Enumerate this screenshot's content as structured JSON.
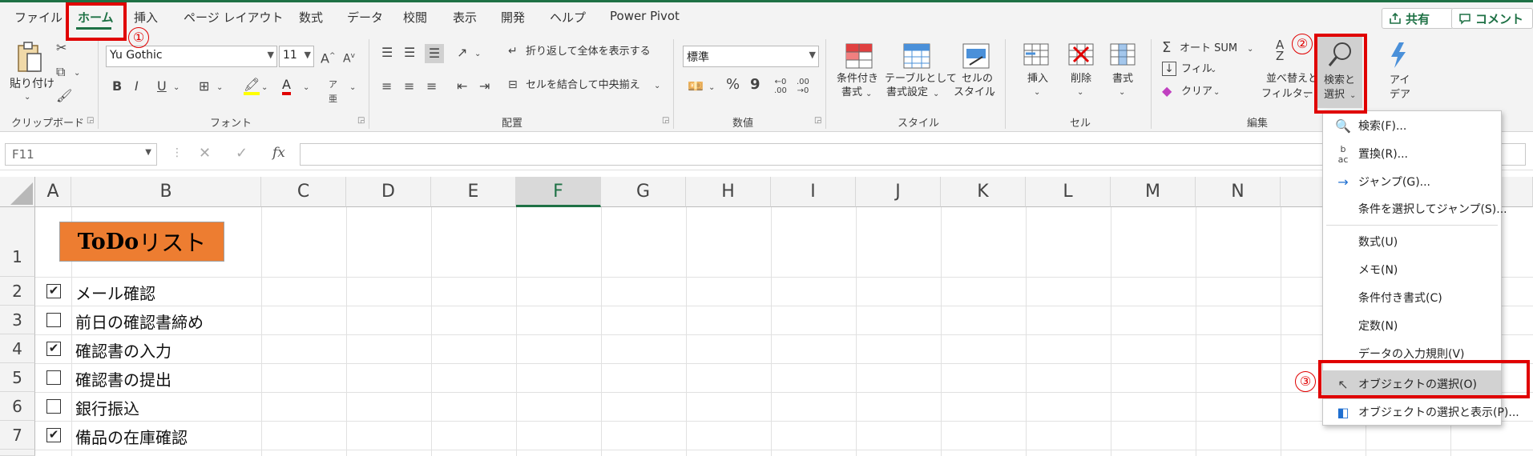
{
  "tabs": [
    "ファイル",
    "ホーム",
    "挿入",
    "ページ レイアウト",
    "数式",
    "データ",
    "校閲",
    "表示",
    "開発",
    "ヘルプ",
    "Power Pivot"
  ],
  "share_label": "共有",
  "comment_label": "コメント",
  "ribbon": {
    "clipboard": {
      "paste": "貼り付け",
      "group": "クリップボード"
    },
    "font": {
      "name": "Yu Gothic",
      "size": "11",
      "group": "フォント"
    },
    "alignment": {
      "wrap": "折り返して全体を表示する",
      "merge": "セルを結合して中央揃え",
      "group": "配置"
    },
    "number": {
      "format": "標準",
      "group": "数値"
    },
    "styles": {
      "cond_l1": "条件付き",
      "cond_l2": "書式",
      "table_l1": "テーブルとして",
      "table_l2": "書式設定",
      "cell_l1": "セルの",
      "cell_l2": "スタイル",
      "group": "スタイル"
    },
    "cells": {
      "insert": "挿入",
      "delete": "削除",
      "format": "書式",
      "group": "セル"
    },
    "editing": {
      "autosum": "オート SUM",
      "fill": "フィル",
      "clear": "クリア",
      "sort_l1": "並べ替えと",
      "sort_l2": "フィルター",
      "find_l1": "検索と",
      "find_l2": "選択",
      "group": "編集"
    },
    "ideas": {
      "l1": "アイ",
      "l2": "デア"
    }
  },
  "annotations": [
    "①",
    "②",
    "③"
  ],
  "formula_bar": {
    "cell_ref": "F11",
    "fx": "fx"
  },
  "columns": [
    "A",
    "B",
    "C",
    "D",
    "E",
    "F",
    "G",
    "H",
    "I",
    "J",
    "K",
    "L",
    "M",
    "N"
  ],
  "rows": [
    "1",
    "2",
    "3",
    "4",
    "5",
    "6",
    "7"
  ],
  "sheet": {
    "title_bold": "ToDo",
    "title_rest": "リスト",
    "tasks": [
      {
        "label": "メール確認",
        "checked": true,
        "mark": "✔"
      },
      {
        "label": "前日の確認書締め",
        "checked": false,
        "mark": ""
      },
      {
        "label": "確認書の入力",
        "checked": true,
        "mark": "✔"
      },
      {
        "label": "確認書の提出",
        "checked": false,
        "mark": ""
      },
      {
        "label": "銀行振込",
        "checked": false,
        "mark": ""
      },
      {
        "label": "備品の在庫確認",
        "checked": true,
        "mark": "✔"
      }
    ]
  },
  "find_menu": [
    "検索(F)...",
    "置換(R)...",
    "ジャンプ(G)...",
    "条件を選択してジャンプ(S)...",
    "数式(U)",
    "メモ(N)",
    "条件付き書式(C)",
    "定数(N)",
    "データの入力規則(V)",
    "オブジェクトの選択(O)",
    "オブジェクトの選択と表示(P)..."
  ],
  "colors": {
    "excel_green": "#1e7145",
    "annotation_red": "#e00000",
    "title_fill": "#ed7d31"
  }
}
